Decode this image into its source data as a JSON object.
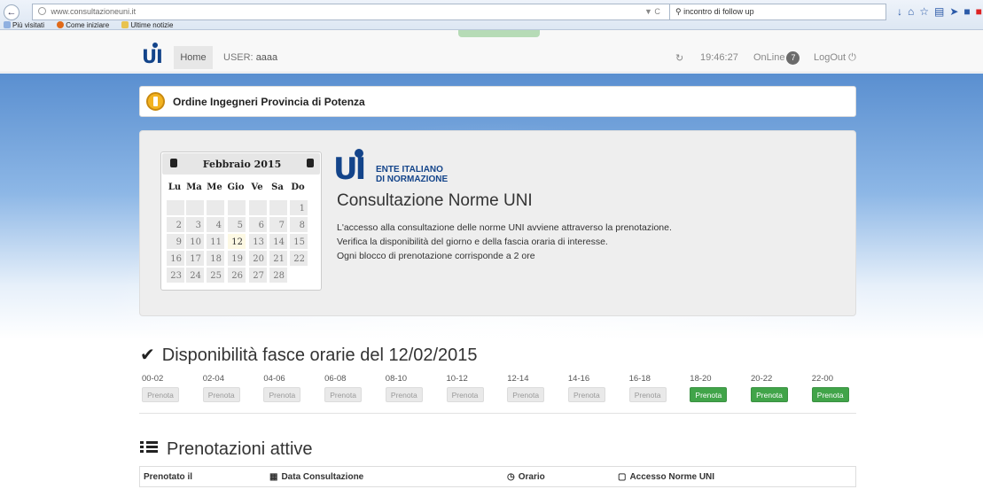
{
  "browser": {
    "url": "www.consultazioneuni.it",
    "search_value": "incontro di follow up",
    "bookmarks": [
      "Più visitati",
      "Come iniziare",
      "Ultime notizie"
    ]
  },
  "appbar": {
    "home_label": "Home",
    "user_prefix": "USER:",
    "user_name": "aaaa",
    "clock": "19:46:27",
    "online_label": "OnLine",
    "online_count": "7",
    "logout_label": "LogOut"
  },
  "org": {
    "name": "Ordine Ingegneri Provincia di Potenza"
  },
  "calendar": {
    "month_label": "Febbraio 2015",
    "weekdays": [
      "Lu",
      "Ma",
      "Me",
      "Gio",
      "Ve",
      "Sa",
      "Do"
    ],
    "today": 12,
    "weeks": [
      [
        "",
        "",
        "",
        "",
        "",
        "",
        "1"
      ],
      [
        "2",
        "3",
        "4",
        "5",
        "6",
        "7",
        "8"
      ],
      [
        "9",
        "10",
        "11",
        "12",
        "13",
        "14",
        "15"
      ],
      [
        "16",
        "17",
        "18",
        "19",
        "20",
        "21",
        "22"
      ],
      [
        "23",
        "24",
        "25",
        "26",
        "27",
        "28",
        ""
      ]
    ]
  },
  "uni": {
    "brand_line1": "ENTE ITALIANO",
    "brand_line2": "DI NORMAZIONE",
    "title": "Consultazione Norme UNI",
    "lines": [
      "L'accesso alla consultazione delle norme UNI avviene attraverso la prenotazione.",
      "Verifica la disponibilità del giorno e della fascia oraria di interesse.",
      "Ogni blocco di prenotazione corrisponde a 2 ore"
    ]
  },
  "availability": {
    "title": "Disponibilità fasce orarie del 12/02/2015",
    "button_label": "Prenota",
    "slots": [
      {
        "label": "00-02",
        "available": false
      },
      {
        "label": "02-04",
        "available": false
      },
      {
        "label": "04-06",
        "available": false
      },
      {
        "label": "06-08",
        "available": false
      },
      {
        "label": "08-10",
        "available": false
      },
      {
        "label": "10-12",
        "available": false
      },
      {
        "label": "12-14",
        "available": false
      },
      {
        "label": "14-16",
        "available": false
      },
      {
        "label": "16-18",
        "available": false
      },
      {
        "label": "18-20",
        "available": true
      },
      {
        "label": "20-22",
        "available": true
      },
      {
        "label": "22-00",
        "available": true
      }
    ],
    "colors": {
      "available": "#41a449",
      "unavailable": "#e9e9e9"
    }
  },
  "bookings": {
    "title": "Prenotazioni attive",
    "columns": [
      "Prenotato il",
      "Data Consultazione",
      "Orario",
      "Accesso Norme UNI"
    ]
  }
}
